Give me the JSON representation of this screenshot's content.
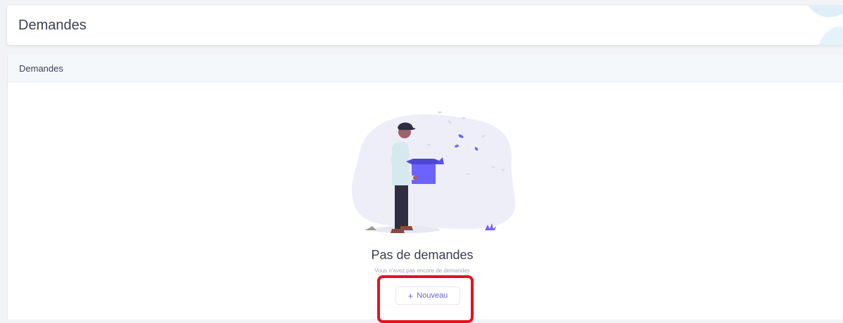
{
  "header": {
    "title": "Demandes"
  },
  "card": {
    "title": "Demandes"
  },
  "empty_state": {
    "illustration_icon": "person-holding-empty-box-illustration",
    "title": "Pas de demandes",
    "subtitle": "Vous n'avez pas encore de demandes",
    "button": {
      "icon": "plus-icon",
      "label": "Nouveau"
    }
  },
  "colors": {
    "accent": "#6c63c9",
    "highlight": "#e8101f",
    "illustration_blob": "#eeeef8"
  }
}
